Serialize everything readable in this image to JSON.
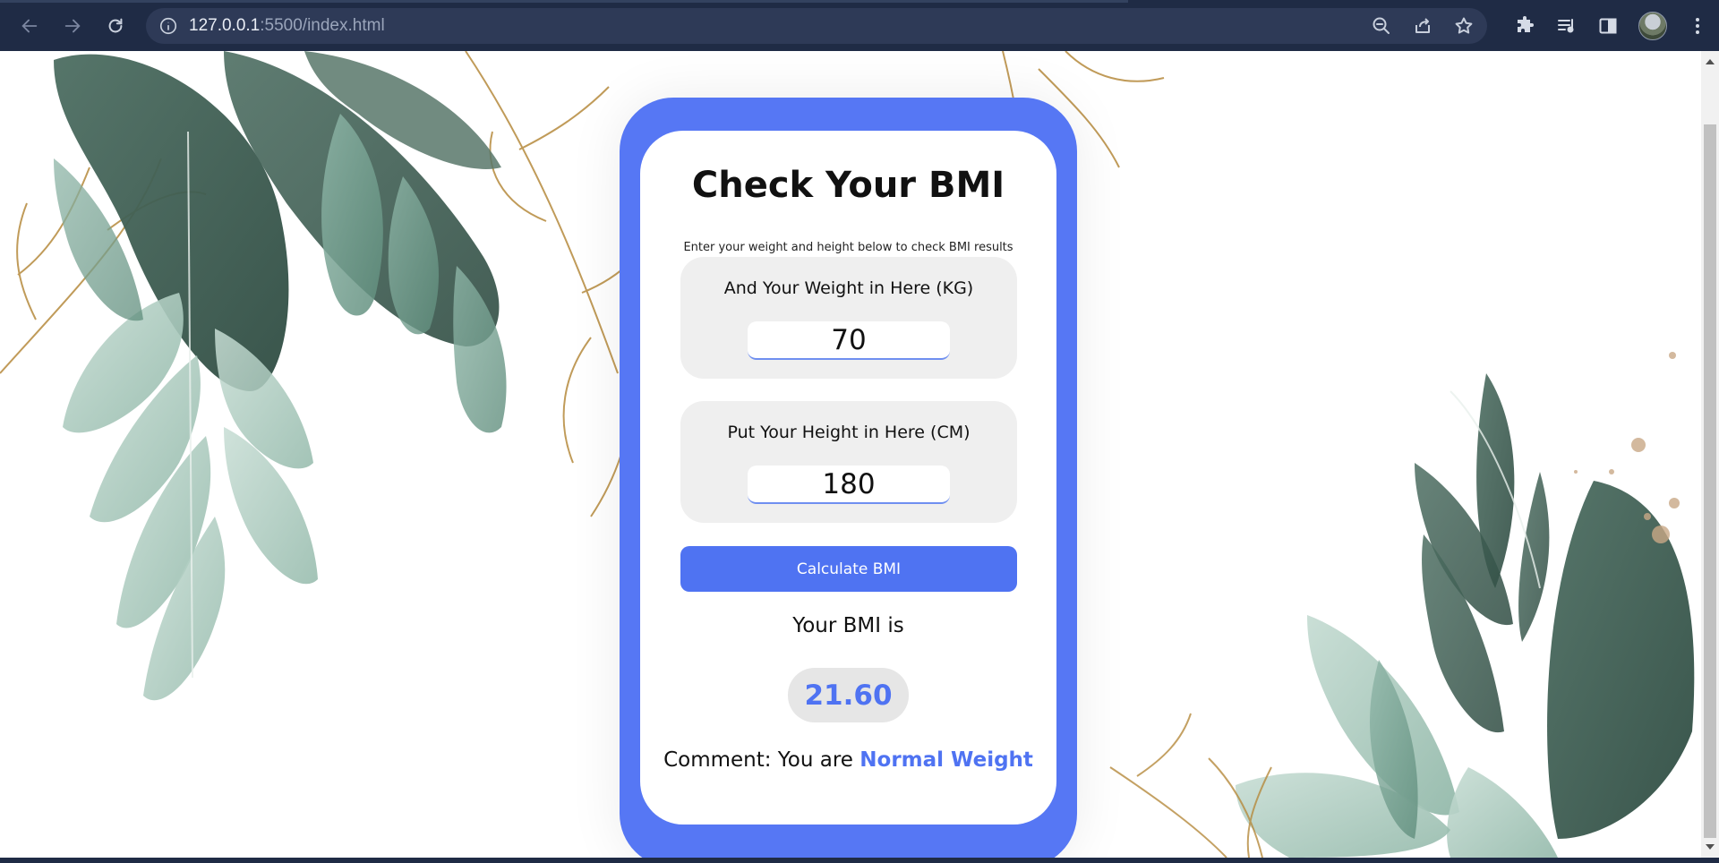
{
  "browser": {
    "url_host": "127.0.0.1",
    "url_path": ":5500/index.html"
  },
  "icons": {
    "back": "back-arrow-icon",
    "forward": "forward-arrow-icon",
    "reload": "reload-icon",
    "site_info": "info-icon",
    "zoom": "zoom-out-icon",
    "share": "share-icon",
    "bookmark": "star-icon",
    "extensions": "puzzle-icon",
    "media": "media-queue-icon",
    "side_panel": "side-panel-icon",
    "menu": "kebab-menu-icon"
  },
  "colors": {
    "browser_bar": "#1f2b45",
    "accent": "#4f73f2",
    "card_frame": "#5677f4"
  },
  "card": {
    "title": "Check Your BMI",
    "subtitle": "Enter your weight and height below to check BMI results",
    "weight": {
      "label": "And Your Weight in Here (KG)",
      "value": "70"
    },
    "height": {
      "label": "Put Your Height in Here (CM)",
      "value": "180"
    },
    "calculate_label": "Calculate BMI",
    "result_label": "Your BMI is",
    "bmi_value": "21.60",
    "comment_prefix": "Comment: You are",
    "comment_value": "Normal Weight"
  }
}
